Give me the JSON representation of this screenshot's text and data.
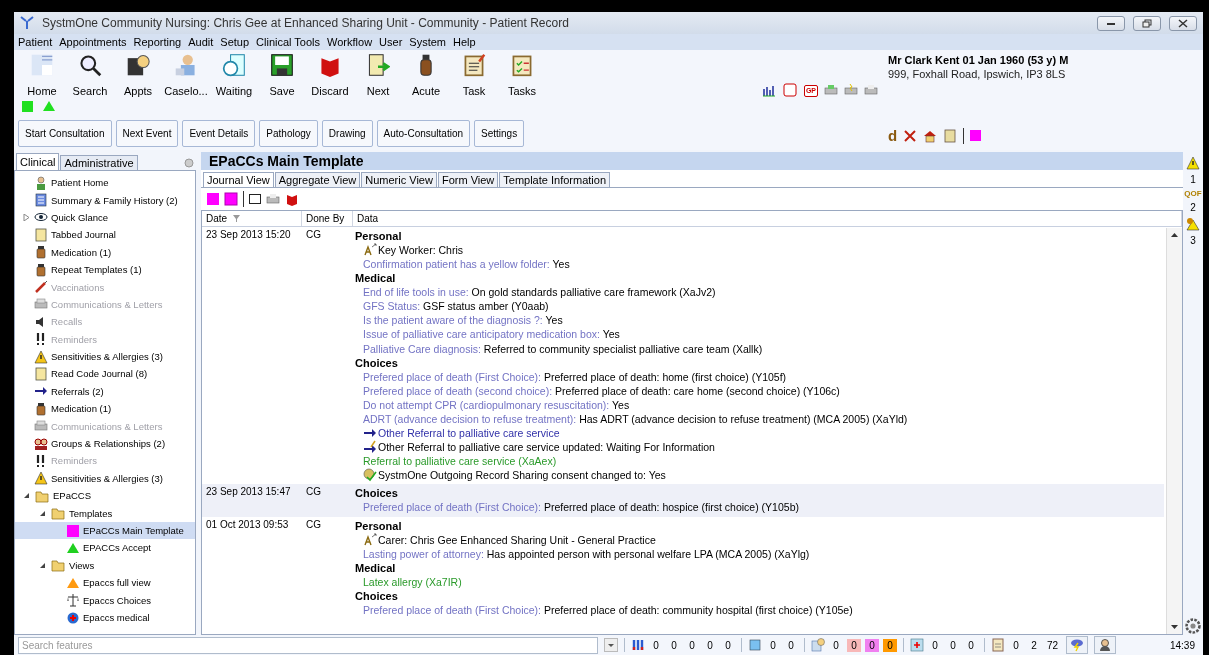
{
  "window": {
    "title": "SystmOne Community Nursing: Chris Gee at Enhanced Sharing Unit - Community - Patient Record"
  },
  "menu": [
    "Patient",
    "Appointments",
    "Reporting",
    "Audit",
    "Setup",
    "Clinical Tools",
    "Workflow",
    "User",
    "System",
    "Help"
  ],
  "toolbar": {
    "buttons": [
      {
        "label": "Home"
      },
      {
        "label": "Search"
      },
      {
        "label": "Appts"
      },
      {
        "label": "Caselo..."
      },
      {
        "label": "Waiting"
      },
      {
        "label": "Save"
      },
      {
        "label": "Discard"
      },
      {
        "label": "Next"
      },
      {
        "label": "Acute"
      },
      {
        "label": "Task"
      },
      {
        "label": "Tasks"
      }
    ],
    "gp_badge": "GP"
  },
  "actions": [
    "Start Consultation",
    "Next Event",
    "Event Details",
    "Pathology",
    "Drawing",
    "Auto-Consultation",
    "Settings"
  ],
  "patient": {
    "name": "Mr Clark Kent 01 Jan 1960 (53 y) M",
    "address": "999, Foxhall Road, Ipswich, IP3 8LS",
    "tool_letter": "d"
  },
  "sidebar": {
    "tabs": [
      {
        "label": "Clinical",
        "selected": true
      },
      {
        "label": "Administrative",
        "selected": false
      }
    ],
    "items": [
      {
        "label": "Patient Home",
        "disabled": false,
        "selected": false
      },
      {
        "label": "Summary & Family History (2)",
        "disabled": false,
        "selected": false
      },
      {
        "label": "Quick Glance",
        "disabled": false,
        "selected": false,
        "expanded": false
      },
      {
        "label": "Tabbed Journal",
        "disabled": false,
        "selected": false
      },
      {
        "label": "Medication (1)",
        "disabled": false,
        "selected": false
      },
      {
        "label": "Repeat Templates (1)",
        "disabled": false,
        "selected": false
      },
      {
        "label": "Vaccinations",
        "disabled": true,
        "selected": false
      },
      {
        "label": "Communications & Letters",
        "disabled": true,
        "selected": false
      },
      {
        "label": "Recalls",
        "disabled": true,
        "selected": false
      },
      {
        "label": "Reminders",
        "disabled": true,
        "selected": false
      },
      {
        "label": "Sensitivities & Allergies (3)",
        "disabled": false,
        "selected": false
      },
      {
        "label": "Read Code Journal (8)",
        "disabled": false,
        "selected": false
      },
      {
        "label": "Referrals (2)",
        "disabled": false,
        "selected": false
      },
      {
        "label": "Medication (1)",
        "disabled": false,
        "selected": false
      },
      {
        "label": "Communications & Letters",
        "disabled": true,
        "selected": false
      },
      {
        "label": "Groups & Relationships (2)",
        "disabled": false,
        "selected": false
      },
      {
        "label": "Reminders",
        "disabled": true,
        "selected": false
      },
      {
        "label": "Sensitivities & Allergies (3)",
        "disabled": false,
        "selected": false
      },
      {
        "label": "EPaCCS",
        "disabled": false,
        "selected": false,
        "expanded": true,
        "children": [
          {
            "label": "Templates",
            "disabled": false,
            "selected": false,
            "expanded": true,
            "children": [
              {
                "label": "EPaCCs Main Template",
                "disabled": false,
                "selected": true
              },
              {
                "label": "EPACCs Accept",
                "disabled": false,
                "selected": false
              }
            ]
          },
          {
            "label": "Views",
            "disabled": false,
            "selected": false,
            "expanded": true,
            "children": [
              {
                "label": "Epaccs full view",
                "disabled": false,
                "selected": false
              },
              {
                "label": "Epaccs Choices",
                "disabled": false,
                "selected": false
              },
              {
                "label": "Epaccs medical",
                "disabled": false,
                "selected": false
              }
            ]
          }
        ]
      }
    ]
  },
  "template": {
    "title": "EPaCCs Main Template",
    "tabs": [
      {
        "label": "Journal View",
        "selected": true
      },
      {
        "label": "Aggregate View",
        "selected": false
      },
      {
        "label": "Numeric View",
        "selected": false
      },
      {
        "label": "Form View",
        "selected": false
      },
      {
        "label": "Template Information",
        "selected": false
      }
    ],
    "columns": [
      "Date",
      "Done By",
      "Data"
    ],
    "entries": [
      {
        "date": "23 Sep 2013 15:20",
        "by": "CG",
        "selected": false,
        "lines": [
          {
            "kind": "heading",
            "text": "Personal"
          },
          {
            "kind": "person",
            "text": "Key Worker:   Chris"
          },
          {
            "kind": "field",
            "label": "Confirmation patient has a yellow folder:",
            "value": "Yes"
          },
          {
            "kind": "heading",
            "text": "Medical"
          },
          {
            "kind": "field",
            "label": "End of life tools in use:",
            "value": "On gold standards palliative care framework (XaJv2)"
          },
          {
            "kind": "field",
            "label": "GFS Status:",
            "value": "GSF status amber (Y0aab)"
          },
          {
            "kind": "field",
            "label": "Is the patient aware of the diagnosis ?:",
            "value": "Yes"
          },
          {
            "kind": "field",
            "label": "Issue of palliative care anticipatory medication box:",
            "value": "Yes"
          },
          {
            "kind": "field",
            "label": "Palliative Care diagnosis:",
            "value": "Referred to community specialist palliative care team (Xallk)"
          },
          {
            "kind": "heading",
            "text": "Choices"
          },
          {
            "kind": "field",
            "label": "Prefered place of death (First Choice):",
            "value": "Preferred place of death: home (first choice) (Y105f)"
          },
          {
            "kind": "field",
            "label": "Prefered place of death (second choice):",
            "value": "Preferred place of death: care home (second choice) (Y106c)"
          },
          {
            "kind": "field",
            "label": "Do not attempt CPR (cardiopulmonary resuscitation):",
            "value": "Yes"
          },
          {
            "kind": "field",
            "label": "ADRT (advance decision to refuse treatment):",
            "value": "Has ADRT (advance decision to refuse treatment) (MCA 2005) (XaYld)"
          },
          {
            "kind": "referral",
            "text": "Other Referral to palliative care service"
          },
          {
            "kind": "update",
            "text": "Other Referral to palliative care service updated: Waiting For Information"
          },
          {
            "kind": "coded",
            "text": "Referral to palliative care service (XaAex)"
          },
          {
            "kind": "consent",
            "text": "SystmOne Outgoing Record Sharing consent changed to: Yes"
          }
        ]
      },
      {
        "date": "23 Sep 2013 15:47",
        "by": "CG",
        "selected": true,
        "lines": [
          {
            "kind": "heading",
            "text": "Choices"
          },
          {
            "kind": "field",
            "label": "Prefered place of death (First Choice):",
            "value": "Preferred place of death: hospice (first choice) (Y105b)"
          }
        ]
      },
      {
        "date": "01 Oct 2013 09:53",
        "by": "CG",
        "selected": false,
        "lines": [
          {
            "kind": "heading",
            "text": "Personal"
          },
          {
            "kind": "person",
            "text": "Carer: Chris Gee Enhanced Sharing Unit - General Practice"
          },
          {
            "kind": "field",
            "label": "Lasting power of attorney:",
            "value": "Has appointed person with personal welfare LPA (MCA 2005) (XaYlg)"
          },
          {
            "kind": "heading",
            "text": "Medical"
          },
          {
            "kind": "coded",
            "text": "Latex allergy (Xa7IR)"
          },
          {
            "kind": "heading",
            "text": "Choices"
          },
          {
            "kind": "field",
            "label": "Prefered place of death (First Choice):",
            "value": "Preferred place of death: community hospital (first choice) (Y105e)"
          }
        ]
      }
    ]
  },
  "rail": {
    "counts": [
      "1",
      "2",
      "3"
    ],
    "qof": "QOF"
  },
  "status_bar": {
    "search_placeholder": "Search features",
    "time": "14:39",
    "groups": [
      {
        "values": [
          {
            "text": "0"
          },
          {
            "text": "0"
          },
          {
            "text": "0"
          },
          {
            "text": "0"
          },
          {
            "text": "0"
          }
        ]
      },
      {
        "values": [
          {
            "text": "0"
          },
          {
            "text": "0"
          }
        ]
      },
      {
        "values": [
          {
            "text": "0"
          },
          {
            "text": "0",
            "color": "#f8b8b8"
          },
          {
            "text": "0",
            "color": "#f080f0"
          },
          {
            "text": "0",
            "color": "#ff9900"
          }
        ]
      },
      {
        "values": [
          {
            "text": "0"
          },
          {
            "text": "0"
          },
          {
            "text": "0"
          }
        ]
      },
      {
        "values": [
          {
            "text": "0"
          },
          {
            "text": "2"
          },
          {
            "text": "72"
          }
        ]
      }
    ]
  }
}
